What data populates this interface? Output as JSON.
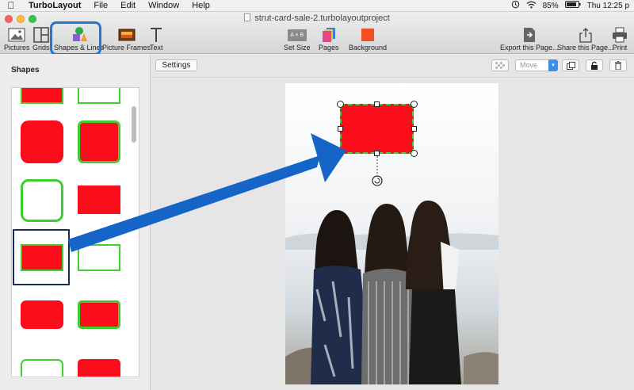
{
  "menubar": {
    "app_name": "TurboLayout",
    "items": [
      "File",
      "Edit",
      "Window",
      "Help"
    ],
    "battery": "85%",
    "clock": "Thu 12:25 p"
  },
  "window": {
    "title": "strut-card-sale-2.turbolayoutproject"
  },
  "toolbar": {
    "pictures": "Pictures",
    "grids": "Grids",
    "shapes_lines": "Shapes & Lines",
    "picture_frames": "Picture Frames",
    "text": "Text",
    "set_size": "Set Size",
    "set_size_icon_text": "A × B",
    "pages": "Pages",
    "background": "Background",
    "export": "Export this Page...",
    "share": "Share this Page...",
    "print": "Print"
  },
  "sidebar": {
    "heading": "Shapes"
  },
  "canvas": {
    "settings_label": "Settings",
    "move_value": "Move"
  },
  "colors": {
    "shape_red": "#fc0d1b",
    "shape_green_outline": "#3ecf2e",
    "highlight_blue": "#1f78d1",
    "arrow_blue": "#1565c8",
    "selection_navy": "#1a2d57"
  }
}
